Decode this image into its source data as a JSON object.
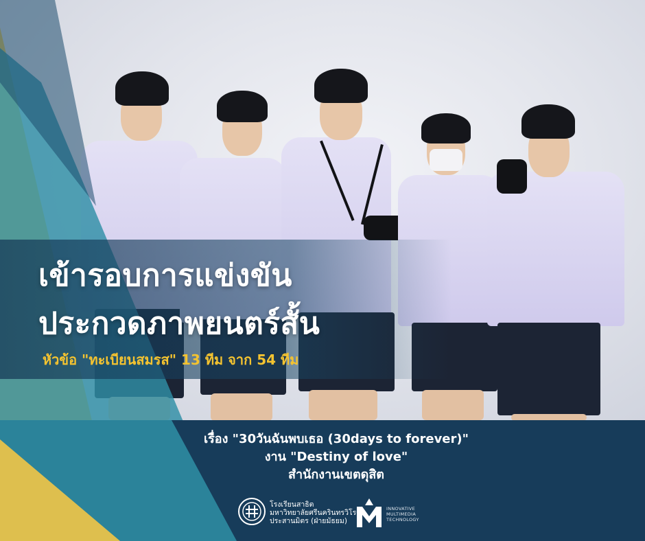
{
  "headline": {
    "line1": "เข้ารอบการแข่งขัน",
    "line2": "ประกวดภาพยนตร์สั้น",
    "subhead": "หัวข้อ \"ทะเบียนสมรส\" 13 ทีม จาก 54 ทีม"
  },
  "info": {
    "line1": "เรื่อง \"30วันฉันพบเธอ (30days to forever)\"",
    "line2": "งาน \"Destiny of love\"",
    "line3": "สำนักงานเขตดุสิต"
  },
  "school": {
    "line1": "โรงเรียนสาธิต",
    "line2": "มหาวิทยาลัยศรีนครินทรวิโรฒ",
    "line3": "ประสานมิตร (ฝ่ายมัธยม)"
  },
  "program": {
    "line1": "INNOVATIVE",
    "line2": "MULTIMEDIA",
    "line3": "TECHNOLOGY"
  },
  "colors": {
    "accent_yellow": "#f4c330",
    "panel_navy": "#173c5a",
    "teal": "#2f8fa6"
  }
}
